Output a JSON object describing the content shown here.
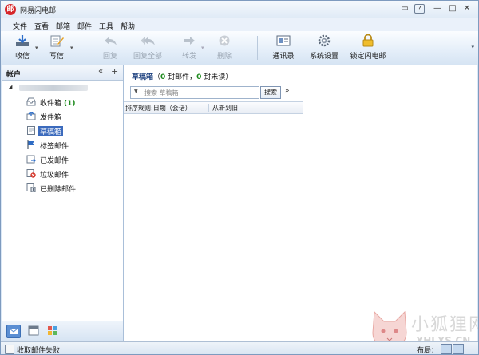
{
  "window": {
    "app_title": "网易闪电邮"
  },
  "menu": [
    "文件",
    "查看",
    "邮箱",
    "邮件",
    "工具",
    "帮助"
  ],
  "toolbar": {
    "receive": "收信",
    "compose": "写信",
    "reply": "回复",
    "reply_all": "回复全部",
    "forward": "转发",
    "delete": "删除",
    "contacts": "通讯录",
    "settings": "系统设置",
    "lock": "锁定闪电邮"
  },
  "left_panel": {
    "title": "帐户",
    "folders": [
      {
        "label": "收件箱",
        "count": "(1)"
      },
      {
        "label": "发件箱"
      },
      {
        "label": "草稿箱"
      },
      {
        "label": "标签邮件"
      },
      {
        "label": "已发邮件"
      },
      {
        "label": "垃圾邮件"
      },
      {
        "label": "已删除邮件"
      }
    ]
  },
  "middle_panel": {
    "folder_name": "草稿箱",
    "summary_open": "（",
    "total": "0",
    "total_suffix": " 封邮件，",
    "unread": "0",
    "unread_suffix": " 封未读）",
    "search_placeholder": "搜索 草稿箱",
    "search_button": "搜索",
    "sort_rule": "排序规则:日期（会话）",
    "sort_order": "从新到旧"
  },
  "status": {
    "message": "收取邮件失败",
    "layout_label": "布局："
  },
  "watermark": {
    "text": "小狐狸网",
    "url": "XHLXS.CN"
  }
}
